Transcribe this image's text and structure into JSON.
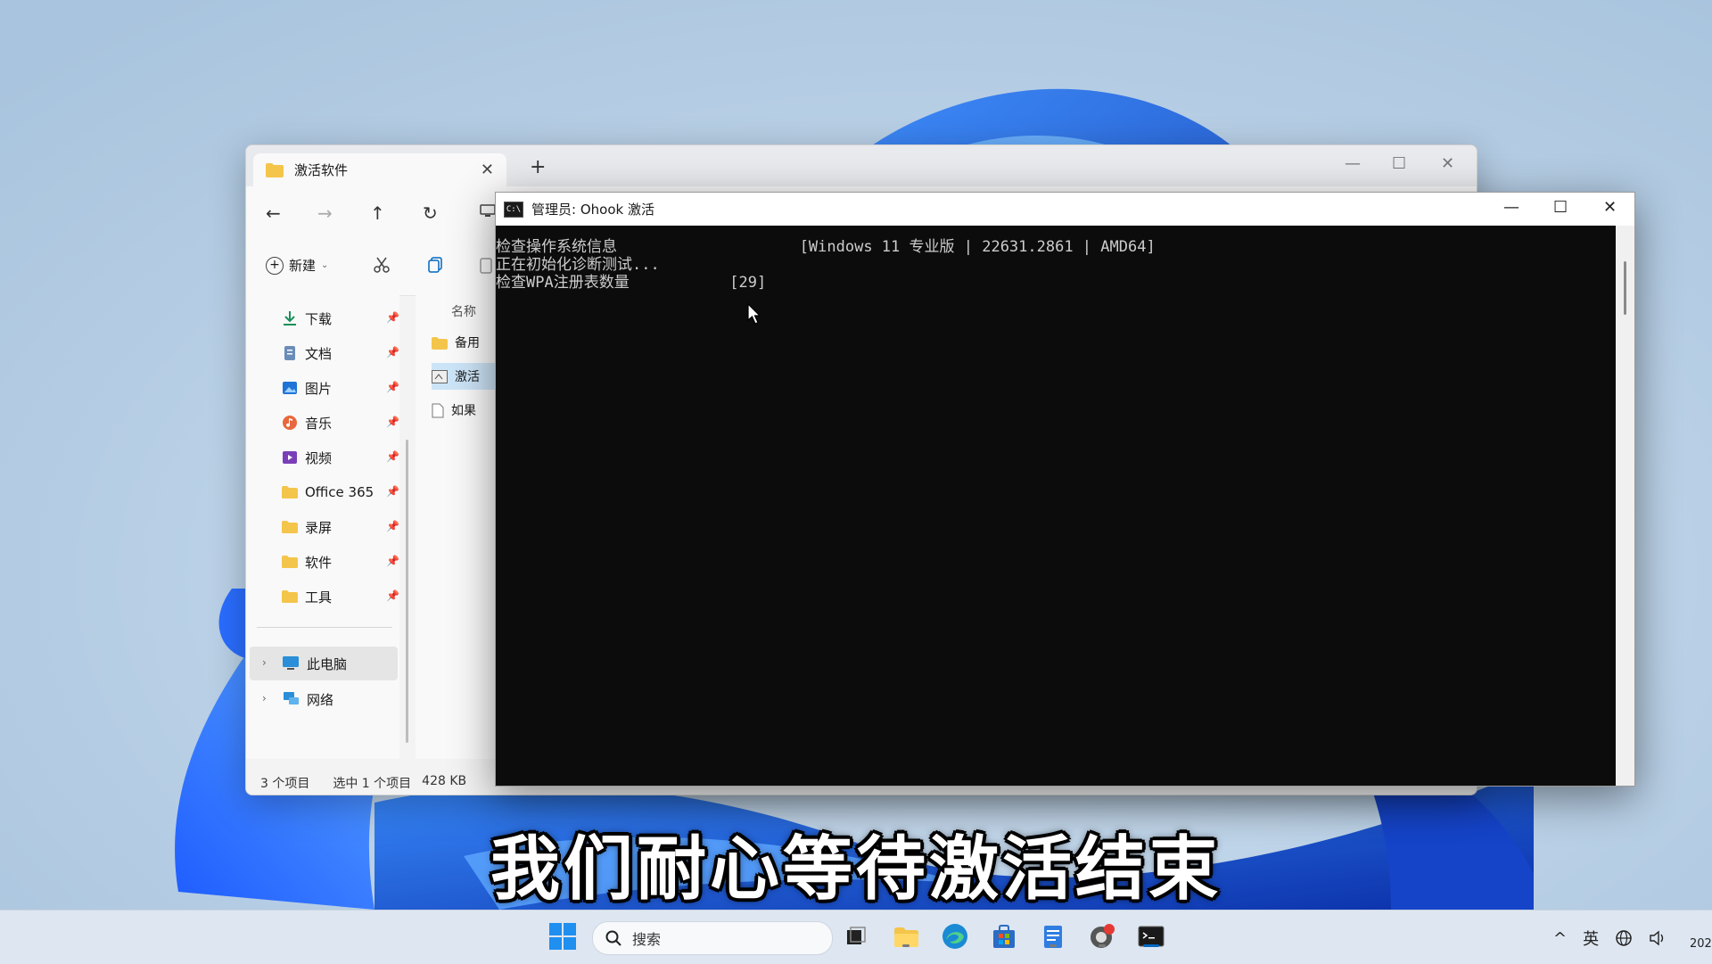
{
  "explorer": {
    "tab_title": "激活软件",
    "toolbar": {
      "new_label": "新建"
    },
    "sidebar": [
      {
        "label": "下载",
        "icon": "download-icon"
      },
      {
        "label": "文档",
        "icon": "document-icon"
      },
      {
        "label": "图片",
        "icon": "picture-icon"
      },
      {
        "label": "音乐",
        "icon": "music-icon"
      },
      {
        "label": "视频",
        "icon": "video-icon"
      },
      {
        "label": "Office 365",
        "icon": "folder-icon"
      },
      {
        "label": "录屏",
        "icon": "folder-icon"
      },
      {
        "label": "软件",
        "icon": "folder-icon"
      },
      {
        "label": "工具",
        "icon": "folder-icon"
      }
    ],
    "this_pc": "此电脑",
    "network": "网络",
    "column_name": "名称",
    "files": [
      {
        "name": "备用",
        "icon": "folder-icon"
      },
      {
        "name": "激活",
        "icon": "script-icon"
      },
      {
        "name": "如果",
        "icon": "text-file-icon"
      }
    ],
    "status": {
      "count": "3 个项目",
      "selected": "选中 1 个项目",
      "size": "428 KB"
    }
  },
  "console": {
    "title": "管理员:  Ohook 激活",
    "lines": [
      "检查操作系统信息                    [Windows 11 专业版 | 22631.2861 | AMD64]",
      "正在初始化诊断测试...",
      "检查WPA注册表数量           [29]"
    ]
  },
  "subtitle": "我们耐心等待激活结束",
  "taskbar": {
    "search_placeholder": "搜索",
    "ime": "英",
    "clock_partial": "202"
  },
  "colors": {
    "accent": "#0067c0",
    "console_bg": "#0c0c0c",
    "console_text": "#cccccc",
    "folder": "#f4c54b"
  }
}
